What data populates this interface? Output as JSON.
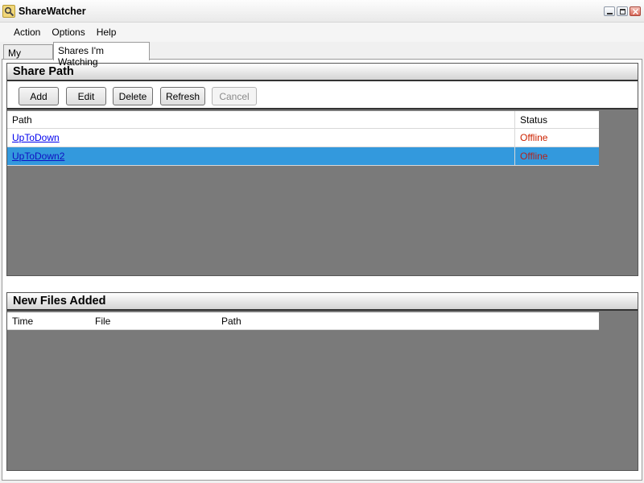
{
  "window": {
    "title": "ShareWatcher",
    "app_icon": "magnifier-icon"
  },
  "menu": {
    "items": [
      "Action",
      "Options",
      "Help"
    ]
  },
  "tabs": [
    {
      "label": "My Shares",
      "active": false
    },
    {
      "label": "Shares I'm Watching",
      "active": true
    }
  ],
  "share_panel": {
    "title": "Share Path",
    "buttons": {
      "add": "Add",
      "edit": "Edit",
      "delete": "Delete",
      "refresh": "Refresh",
      "cancel": "Cancel"
    },
    "columns": {
      "path": "Path",
      "status": "Status"
    },
    "rows": [
      {
        "path": "UpToDown",
        "status": "Offline",
        "selected": false
      },
      {
        "path": "UpToDown2",
        "status": "Offline",
        "selected": true
      }
    ]
  },
  "files_panel": {
    "title": "New Files Added",
    "columns": {
      "time": "Time",
      "file": "File",
      "path": "Path"
    }
  },
  "colors": {
    "selection": "#3399dd",
    "offline": "#cc2200",
    "panel_background": "#7a7a7a"
  }
}
